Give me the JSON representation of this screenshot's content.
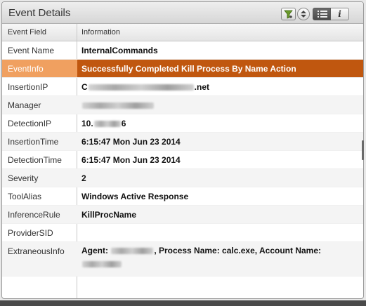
{
  "panel": {
    "title": "Event Details"
  },
  "toolbar": {
    "filter_icon": "filter-add-icon",
    "sort_icon": "sort-updown-icon",
    "list_view_icon": "list-view-icon",
    "info_label": "i"
  },
  "table": {
    "headers": {
      "field": "Event Field",
      "info": "Information"
    },
    "rows": [
      {
        "field": "Event Name",
        "value": "InternalCommands"
      },
      {
        "field": "EventInfo",
        "value": "Successfully Completed Kill Process By Name Action",
        "selected": true
      },
      {
        "field": "InsertionIP",
        "prefix": "C",
        "suffix": ".net"
      },
      {
        "field": "Manager"
      },
      {
        "field": "DetectionIP",
        "prefix": "10.",
        "suffix": "6"
      },
      {
        "field": "InsertionTime",
        "value": "6:15:47 Mon Jun 23 2014"
      },
      {
        "field": "DetectionTime",
        "value": "6:15:47 Mon Jun 23 2014"
      },
      {
        "field": "Severity",
        "value": "2"
      },
      {
        "field": "ToolAlias",
        "value": "Windows Active Response"
      },
      {
        "field": "InferenceRule",
        "value": "KillProcName"
      },
      {
        "field": "ProviderSID",
        "value": ""
      },
      {
        "field": "ExtraneousInfo",
        "agent_label": "Agent:",
        "process_text": ", Process Name: calc.exe, Account Name:"
      }
    ]
  },
  "colors": {
    "selected_row": "#f0a060",
    "selected_info": "#c0570f",
    "accent_green": "#6a9a2a"
  }
}
